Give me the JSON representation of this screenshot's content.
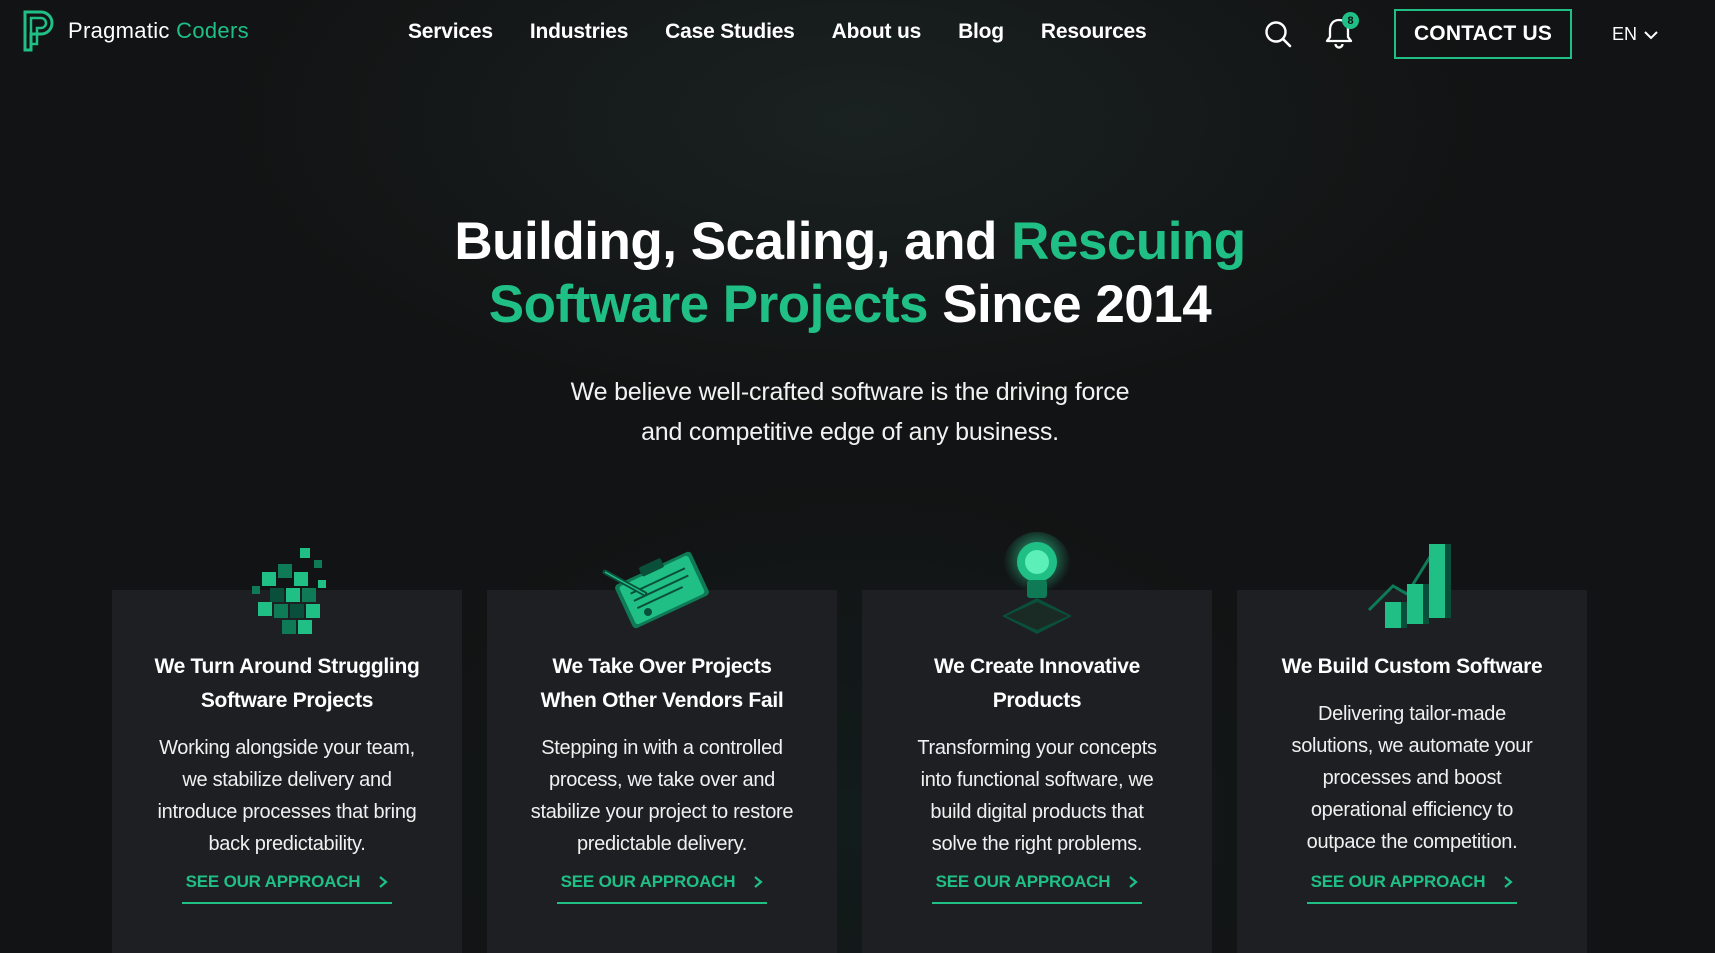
{
  "brand": {
    "name_main": "Pragmatic",
    "name_accent": "Coders",
    "accent_color": "#1fbf86",
    "background_color": "#121314",
    "card_color": "#1e1f22"
  },
  "nav": {
    "items": [
      {
        "label": "Services"
      },
      {
        "label": "Industries"
      },
      {
        "label": "Case Studies"
      },
      {
        "label": "About us"
      },
      {
        "label": "Blog"
      },
      {
        "label": "Resources"
      }
    ],
    "search_icon": "search-icon",
    "bell_icon": "bell-icon",
    "notification_count": "8",
    "contact_label": "CONTACT US",
    "language": "EN"
  },
  "hero": {
    "title_part1": "Building, Scaling, and",
    "title_highlight1": "Rescuing",
    "title_highlight2": "Software Projects",
    "title_part2": "Since 2014",
    "subtitle_line1": "We believe well-crafted software is the driving force",
    "subtitle_line2": "and competitive edge of any business."
  },
  "cards": [
    {
      "icon": "cube-blocks-icon",
      "title_line1": "We Turn Around Struggling",
      "title_line2": "Software Projects",
      "desc_lines": [
        "Working alongside your team,",
        "we stabilize delivery and",
        "introduce processes that bring",
        "back predictability."
      ],
      "link_label": "SEE OUR APPROACH"
    },
    {
      "icon": "clipboard-pen-icon",
      "title_line1": "We Take Over Projects",
      "title_line2": "When Other Vendors Fail",
      "desc_lines": [
        "Stepping in with a controlled",
        "process, we take over and",
        "stabilize your project to restore",
        "predictable delivery."
      ],
      "link_label": "SEE OUR APPROACH"
    },
    {
      "icon": "lightbulb-icon",
      "title_line1": "We Create Innovative",
      "title_line2": "Products",
      "desc_lines": [
        "Transforming your concepts",
        "into functional software, we",
        "build digital products that",
        "solve the right problems."
      ],
      "link_label": "SEE OUR APPROACH"
    },
    {
      "icon": "growth-chart-icon",
      "title_line1": "We Build Custom Software",
      "title_line2": "",
      "desc_lines": [
        "Delivering tailor-made",
        "solutions, we automate your",
        "processes and boost",
        "operational efficiency to",
        "outpace the competition."
      ],
      "link_label": "SEE OUR APPROACH"
    }
  ]
}
